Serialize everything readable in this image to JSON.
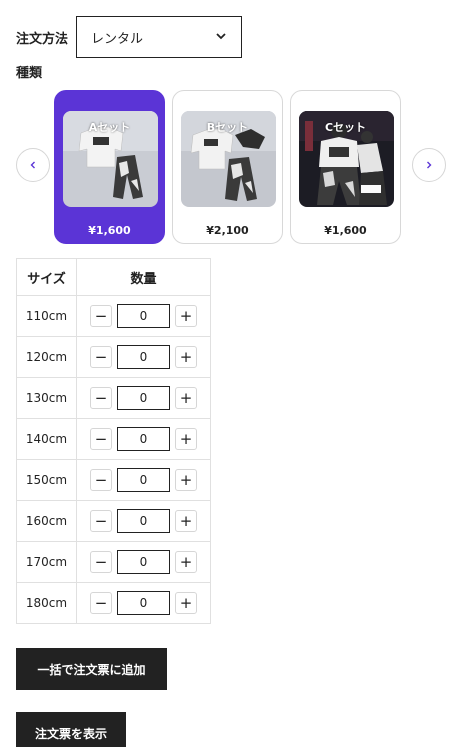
{
  "order": {
    "label": "注文方法",
    "selected": "レンタル"
  },
  "kind": {
    "label": "種類"
  },
  "carousel": {
    "prev_icon": "chevron-left-icon",
    "next_icon": "chevron-right-icon",
    "sets": [
      {
        "name": "Aセット",
        "price": "¥1,600",
        "active": true
      },
      {
        "name": "Bセット",
        "price": "¥2,100",
        "active": false
      },
      {
        "name": "Cセット",
        "price": "¥1,600",
        "active": false
      }
    ]
  },
  "table": {
    "headers": [
      "サイズ",
      "数量"
    ],
    "rows": [
      {
        "size": "110cm",
        "qty": "0"
      },
      {
        "size": "120cm",
        "qty": "0"
      },
      {
        "size": "130cm",
        "qty": "0"
      },
      {
        "size": "140cm",
        "qty": "0"
      },
      {
        "size": "150cm",
        "qty": "0"
      },
      {
        "size": "160cm",
        "qty": "0"
      },
      {
        "size": "170cm",
        "qty": "0"
      },
      {
        "size": "180cm",
        "qty": "0"
      }
    ],
    "minus": "−",
    "plus": "+"
  },
  "buttons": {
    "bulk_add": "一括で注文票に追加",
    "show_order": "注文票を表示"
  },
  "colors": {
    "accent": "#5b34d6",
    "button_dark": "#222222"
  }
}
